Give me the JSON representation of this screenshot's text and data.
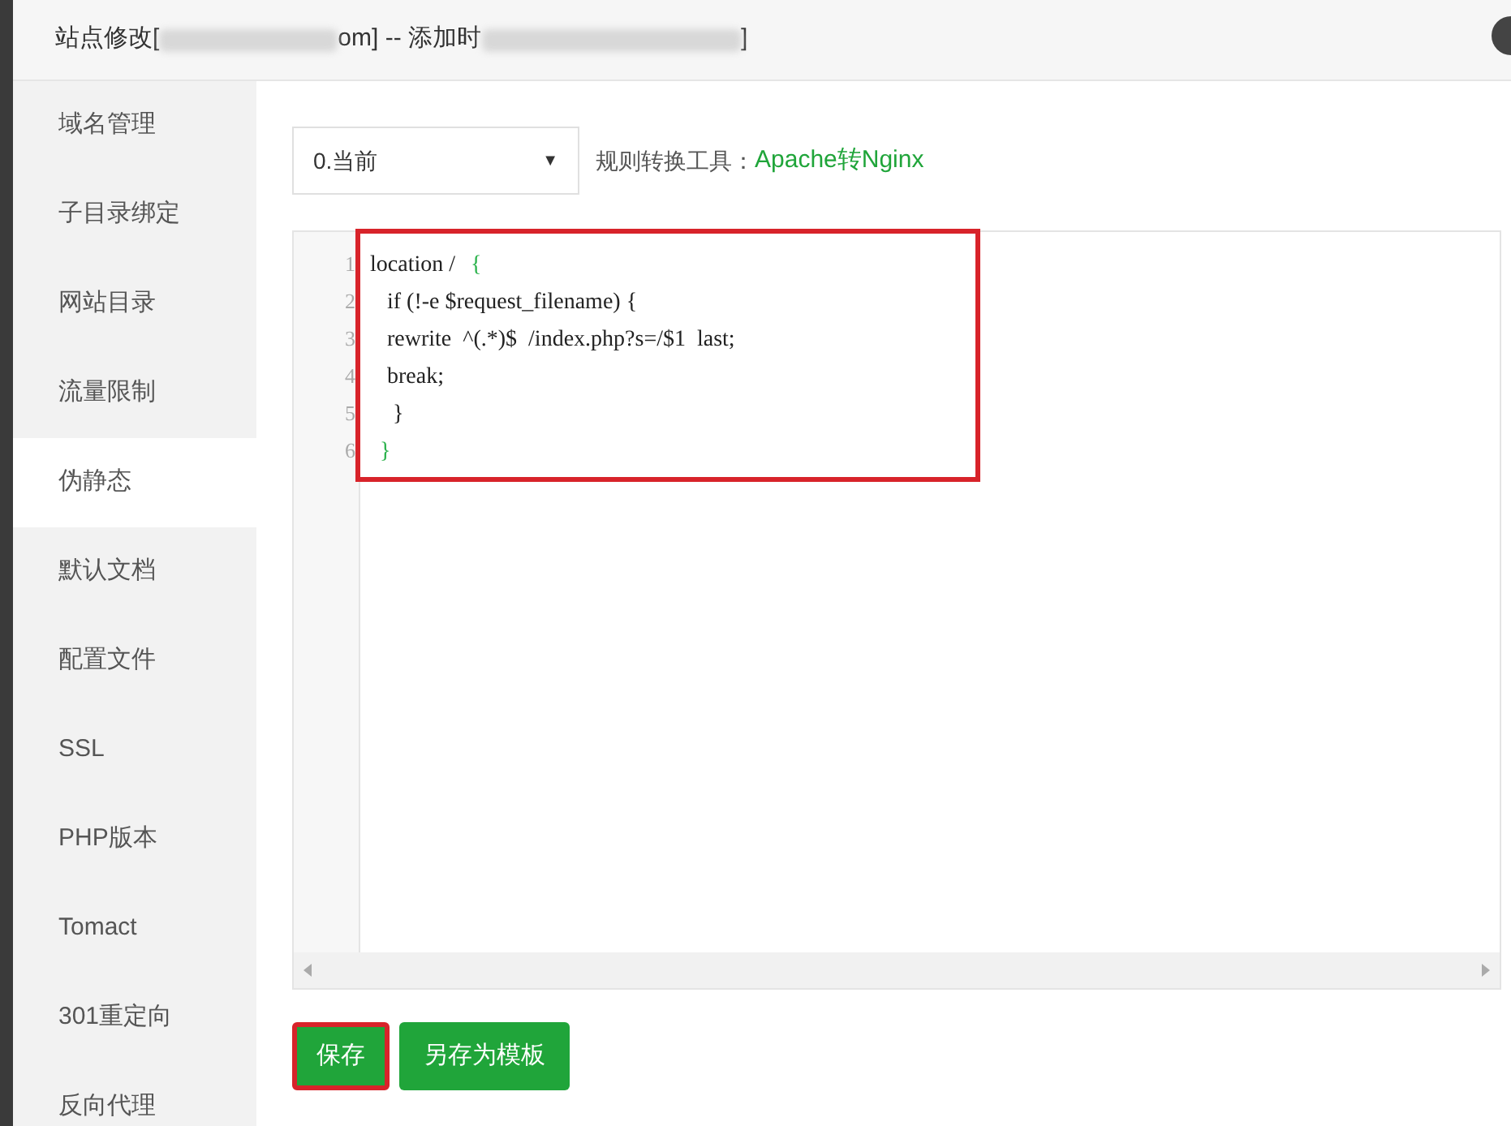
{
  "window": {
    "title_parts": [
      "站点修改[",
      "om] -- 添加时",
      "]"
    ]
  },
  "sidebar": {
    "items": [
      {
        "label": "域名管理",
        "selected": false
      },
      {
        "label": "子目录绑定",
        "selected": false
      },
      {
        "label": "网站目录",
        "selected": false
      },
      {
        "label": "流量限制",
        "selected": false
      },
      {
        "label": "伪静态",
        "selected": true
      },
      {
        "label": "默认文档",
        "selected": false
      },
      {
        "label": "配置文件",
        "selected": false
      },
      {
        "label": "SSL",
        "selected": false
      },
      {
        "label": "PHP版本",
        "selected": false
      },
      {
        "label": "Tomact",
        "selected": false
      },
      {
        "label": "301重定向",
        "selected": false
      },
      {
        "label": "反向代理",
        "selected": false
      }
    ]
  },
  "template_select": {
    "value": "0.当前",
    "arrow": "▼"
  },
  "converter": {
    "label": "规则转换工具：",
    "link": "Apache转Nginx"
  },
  "editor": {
    "lines": [
      {
        "number": "1",
        "segments": [
          {
            "text": "location / ",
            "match": false
          },
          {
            "text": "{",
            "match": true
          }
        ]
      },
      {
        "number": "2",
        "segments": [
          {
            "text": "   if (!-e $request_filename) {",
            "match": false
          }
        ]
      },
      {
        "number": "3",
        "segments": [
          {
            "text": "   rewrite  ^(.*)$  /index.php?s=/$1  last;",
            "match": false
          }
        ]
      },
      {
        "number": "4",
        "segments": [
          {
            "text": "   break;",
            "match": false
          }
        ]
      },
      {
        "number": "5",
        "segments": [
          {
            "text": "    }",
            "match": false
          }
        ]
      },
      {
        "number": "6",
        "segments": [
          {
            "text": "}",
            "match": true
          }
        ]
      }
    ]
  },
  "buttons": [
    {
      "label": "保存",
      "highlighted": true
    },
    {
      "label": "另存为模板",
      "highlighted": false
    }
  ]
}
